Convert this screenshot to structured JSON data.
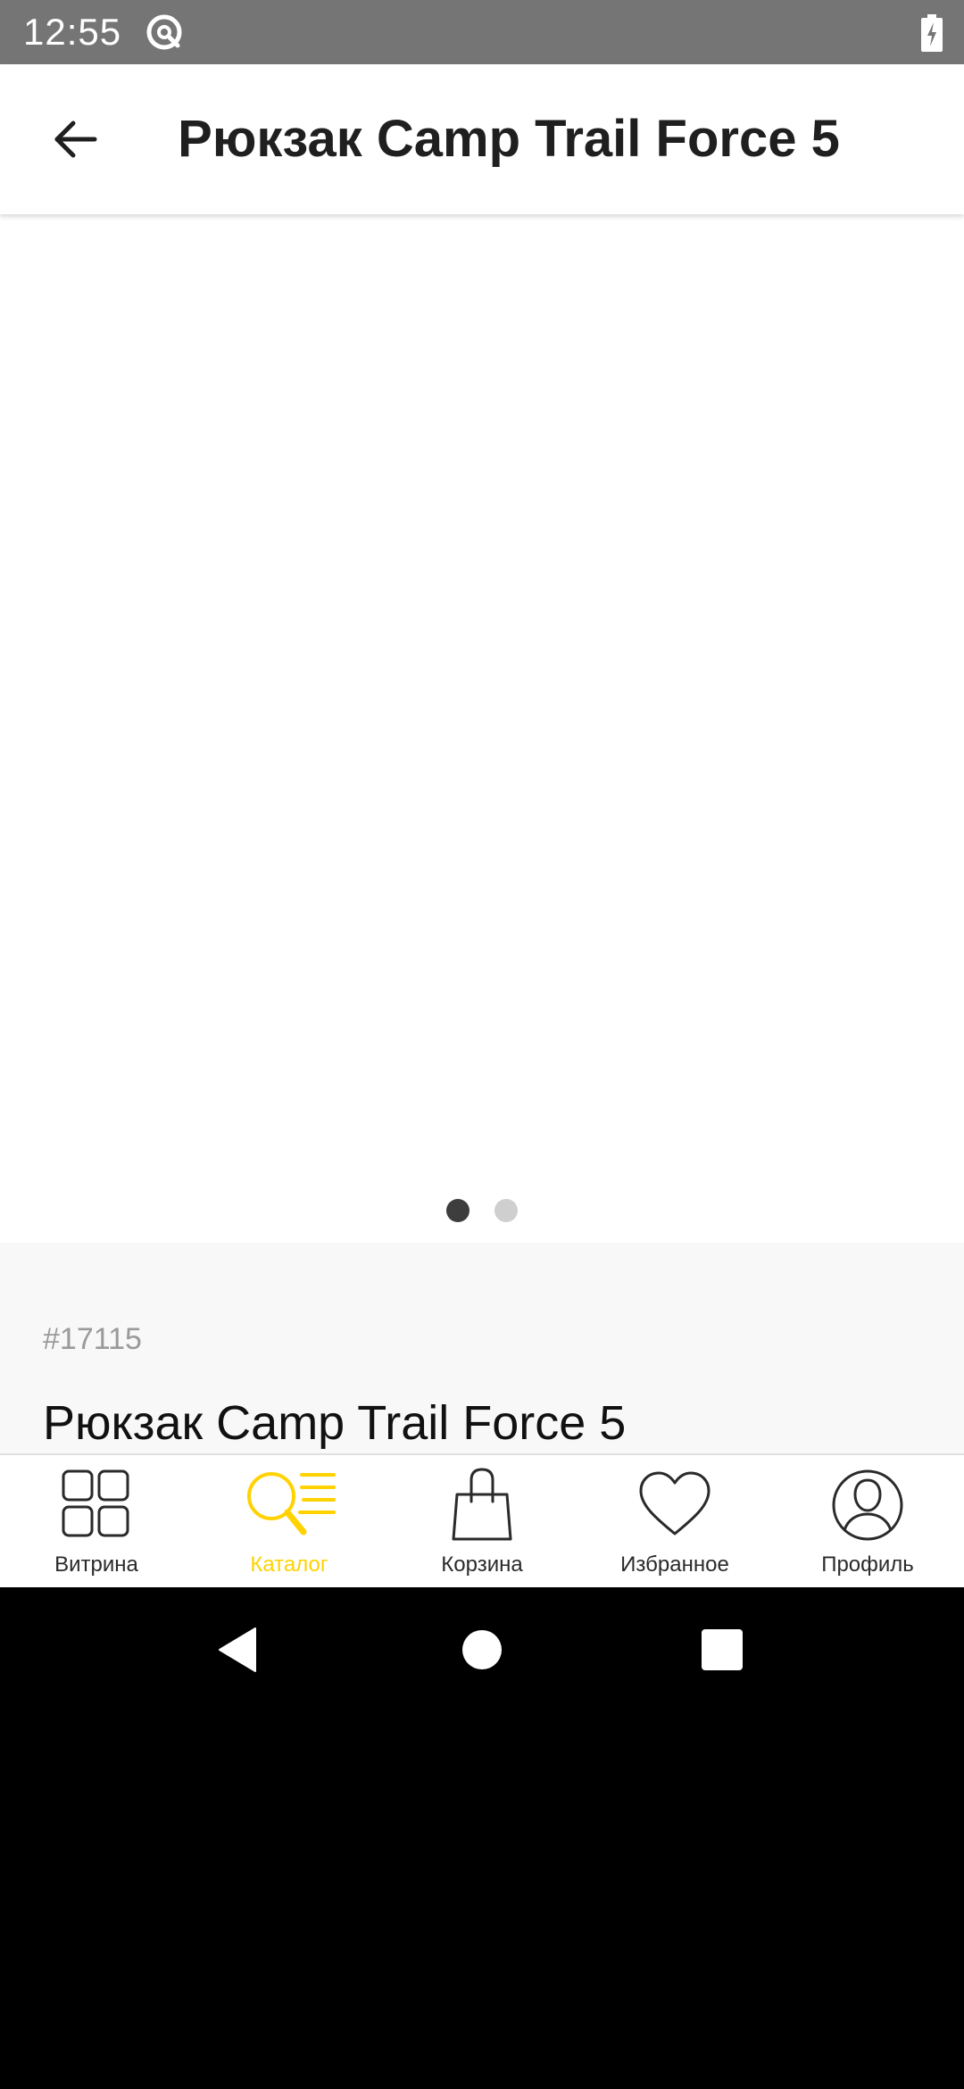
{
  "status_bar": {
    "time": "12:55",
    "icons": [
      "sync-icon",
      "battery-charging-icon"
    ]
  },
  "app_bar": {
    "back_icon": "arrow-left-icon",
    "title": "Рюкзак Camp Trail Force 5"
  },
  "gallery": {
    "page_count": 2,
    "active_page": 1
  },
  "product": {
    "sku": "#17115",
    "name": "Рюкзак Camp Trail Force 5"
  },
  "bottom_nav": {
    "items": [
      {
        "label": "Витрина",
        "icon": "grid-icon",
        "active": false
      },
      {
        "label": "Каталог",
        "icon": "search-list-icon",
        "active": true
      },
      {
        "label": "Корзина",
        "icon": "shopping-bag-icon",
        "active": false
      },
      {
        "label": "Избранное",
        "icon": "heart-icon",
        "active": false
      },
      {
        "label": "Профиль",
        "icon": "profile-icon",
        "active": false
      }
    ]
  },
  "colors": {
    "accent": "#ffd200",
    "status_bar": "#757575",
    "text": "#1f1f1f",
    "muted": "#9a9a9a"
  }
}
